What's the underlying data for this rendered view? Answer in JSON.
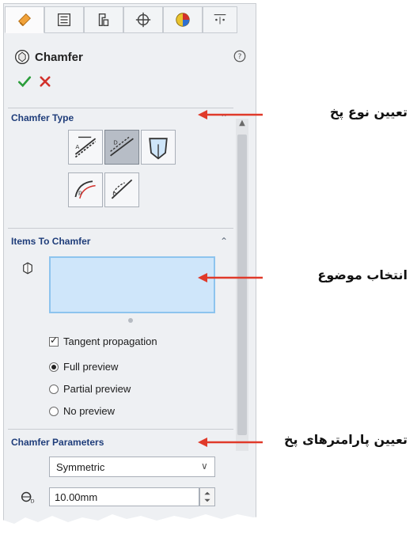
{
  "panel": {
    "title": "Chamfer",
    "tabs": [
      {
        "icon": "feature-manager-icon",
        "active": true
      },
      {
        "icon": "property-manager-icon",
        "active": false
      },
      {
        "icon": "configuration-manager-icon",
        "active": false
      },
      {
        "icon": "dimxpert-manager-icon",
        "active": false
      },
      {
        "icon": "display-manager-icon",
        "active": false
      },
      {
        "icon": "more-tabs-icon",
        "active": false
      }
    ],
    "chamfer_type": {
      "title": "Chamfer Type",
      "options": [
        {
          "icon": "angle-distance-icon",
          "selected": false
        },
        {
          "icon": "distance-distance-icon",
          "selected": true
        },
        {
          "icon": "vertex-icon",
          "selected": false
        },
        {
          "icon": "offset-face-icon",
          "selected": false
        },
        {
          "icon": "face-face-icon",
          "selected": false
        }
      ]
    },
    "items": {
      "title": "Items To Chamfer",
      "tangent_propagation": {
        "label": "Tangent propagation",
        "checked": true
      },
      "preview": [
        {
          "label": "Full preview",
          "selected": true
        },
        {
          "label": "Partial preview",
          "selected": false
        },
        {
          "label": "No preview",
          "selected": false
        }
      ]
    },
    "parameters": {
      "title": "Chamfer Parameters",
      "mode": "Symmetric",
      "distance": "10.00mm"
    }
  },
  "annotations": {
    "type": "تعیین نوع پخ",
    "selection": "انتخاب موضوع",
    "parameters": "تعیین پارامترهای پخ"
  },
  "colors": {
    "accent": "#1f3d7a",
    "ok": "#2a9d3a",
    "cancel": "#d2302b",
    "arrow": "#e03a2a",
    "selection_fill": "#cfe6fa"
  }
}
